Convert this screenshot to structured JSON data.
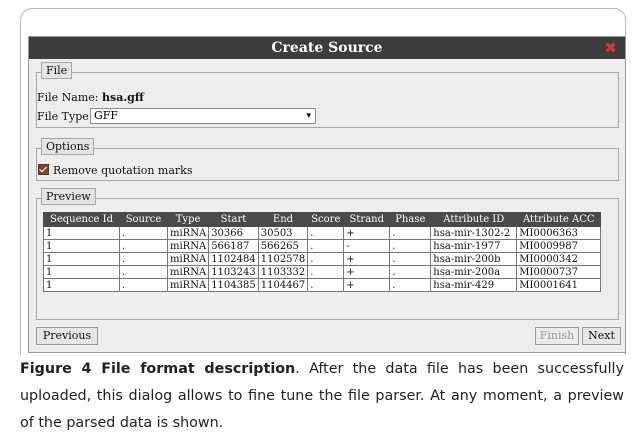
{
  "dialog": {
    "title": "Create Source",
    "close_glyph": "✖"
  },
  "file_section": {
    "legend": "File",
    "file_name_label": "File Name:",
    "file_name_value": "hsa.gff",
    "file_type_label": "File Type",
    "file_type_value": "GFF"
  },
  "options_section": {
    "legend": "Options",
    "remove_quotes_label": "Remove quotation marks",
    "remove_quotes_checked": true
  },
  "preview_section": {
    "legend": "Preview",
    "columns": [
      "Sequence Id",
      "Source",
      "Type",
      "Start",
      "End",
      "Score",
      "Strand",
      "Phase",
      "Attribute ID",
      "Attribute ACC"
    ],
    "rows": [
      [
        "1",
        ".",
        "miRNA",
        "30366",
        "30503",
        ".",
        "+",
        ".",
        "hsa-mir-1302-2",
        "MI0006363"
      ],
      [
        "1",
        ".",
        "miRNA",
        "566187",
        "566265",
        ".",
        "-",
        ".",
        "hsa-mir-1977",
        "MI0009987"
      ],
      [
        "1",
        ".",
        "miRNA",
        "1102484",
        "1102578",
        ".",
        "+",
        ".",
        "hsa-mir-200b",
        "MI0000342"
      ],
      [
        "1",
        ".",
        "miRNA",
        "1103243",
        "1103332",
        ".",
        "+",
        ".",
        "hsa-mir-200a",
        "MI0000737"
      ],
      [
        "1",
        ".",
        "miRNA",
        "1104385",
        "1104467",
        ".",
        "+",
        ".",
        "hsa-mir-429",
        "MI0001641"
      ]
    ]
  },
  "buttons": {
    "previous": "Previous",
    "finish": "Finish",
    "next": "Next"
  },
  "caption": {
    "label": "Figure 4 File format description",
    "text": ". After the data file has been successfully uploaded, this dialog allows to fine tune the file parser. At any moment, a preview of the parsed data is shown."
  }
}
